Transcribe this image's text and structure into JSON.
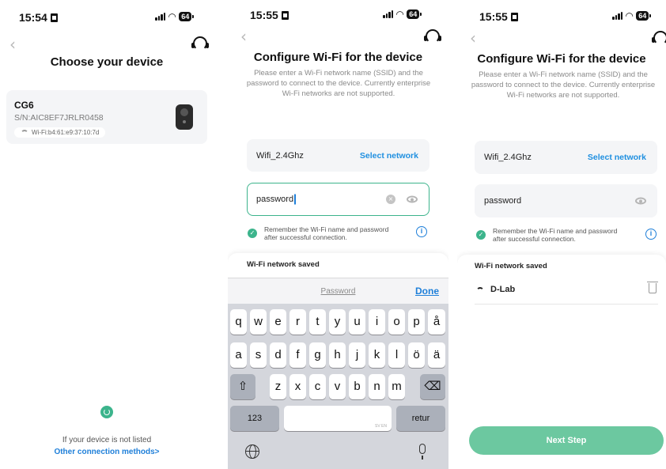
{
  "colors": {
    "accent": "#3cb48c",
    "link": "#1e7fd9",
    "next_button": "#6cc8a0"
  },
  "status_bar": [
    {
      "time": "15:54",
      "battery": "64"
    },
    {
      "time": "15:55",
      "battery": "64"
    },
    {
      "time": "15:55",
      "battery": "64"
    }
  ],
  "screen1": {
    "title": "Choose your device",
    "device": {
      "name": "CG6",
      "serial": "S/N:AIC8EF7JRLR0458",
      "mac": "Wi-Fi:b4:61:e9:37:10:7d"
    },
    "not_listed": "If your device is not listed",
    "other_methods": "Other connection methods>"
  },
  "screen2": {
    "title": "Configure Wi-Fi for the device",
    "description": "Please enter a Wi-Fi network name (SSID) and the password to connect to the device. Currently enterprise Wi-Fi networks are not supported.",
    "ssid": "Wifi_2.4Ghz",
    "select_network": "Select network",
    "password_value": "password",
    "remember_line1": "Remember the Wi-Fi name and password",
    "remember_line2": "after successful connection.",
    "info": "i",
    "saved_title": "Wi-Fi network saved",
    "keyboard": {
      "field_label": "Password",
      "done": "Done",
      "row1": [
        "q",
        "w",
        "e",
        "r",
        "t",
        "y",
        "u",
        "i",
        "o",
        "p",
        "å"
      ],
      "row2": [
        "a",
        "s",
        "d",
        "f",
        "g",
        "h",
        "j",
        "k",
        "l",
        "ö",
        "ä"
      ],
      "row3": [
        "z",
        "x",
        "c",
        "v",
        "b",
        "n",
        "m"
      ],
      "numbers": "123",
      "space_hint": "SV EN",
      "return": "retur"
    }
  },
  "screen3": {
    "title": "Configure Wi-Fi for the device",
    "description": "Please enter a Wi-Fi network name (SSID) and the password to connect to the device. Currently enterprise Wi-Fi networks are not supported.",
    "ssid": "Wifi_2.4Ghz",
    "select_network": "Select network",
    "password_value": "password",
    "remember_line1": "Remember the Wi-Fi name and password",
    "remember_line2": "after successful connection.",
    "info": "i",
    "saved_title": "Wi-Fi network saved",
    "saved_networks": [
      {
        "name": "D-Lab"
      }
    ],
    "next_step": "Next Step"
  }
}
